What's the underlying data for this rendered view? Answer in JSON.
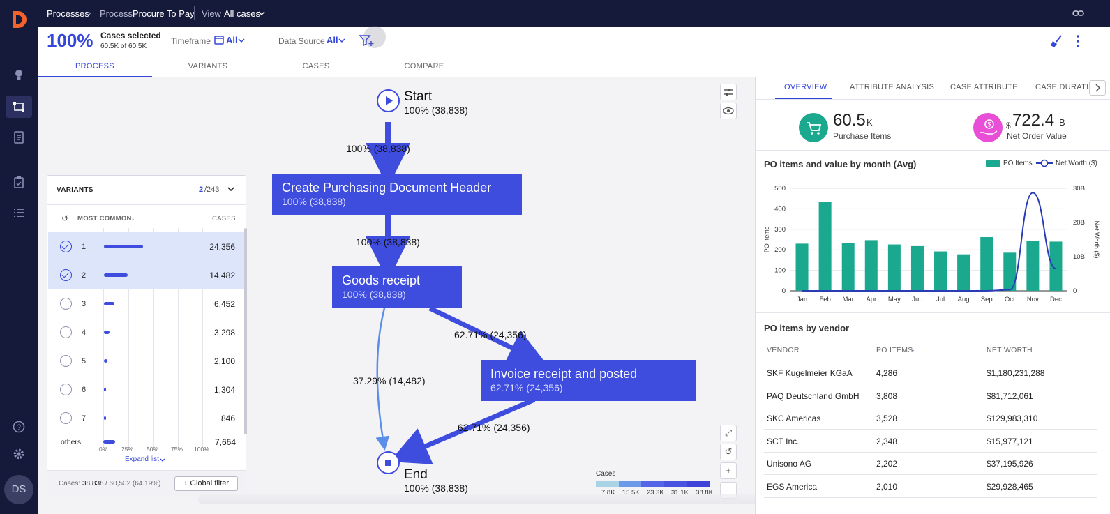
{
  "topbar": {
    "processes": "Processes",
    "process_label": "Process",
    "process_name": "Procure To Pay",
    "view_label": "View",
    "view_value": "All cases"
  },
  "filterbar": {
    "percent": "100%",
    "cases_selected": "Cases selected",
    "cases_count": "60.5K of 60.5K",
    "timeframe_label": "Timeframe",
    "timeframe_value": "All",
    "datasource_label": "Data Source",
    "datasource_value": "All"
  },
  "tabs": [
    "PROCESS",
    "VARIANTS",
    "CASES",
    "COMPARE"
  ],
  "flow": {
    "start_title": "Start",
    "start_sub": "100% (38,838)",
    "end_title": "End",
    "end_sub": "100% (38,838)",
    "nodes": [
      {
        "title": "Create Purchasing Document Header",
        "sub": "100% (38,838)"
      },
      {
        "title": "Goods receipt",
        "sub": "100% (38,838)"
      },
      {
        "title": "Invoice receipt and posted",
        "sub": "62.71% (24,356)"
      }
    ],
    "edges": [
      "100% (38,838)",
      "100% (38,838)",
      "62.71% (24,356)",
      "37.29% (14,482)",
      "62.71% (24,356)"
    ],
    "legend": {
      "title": "Cases",
      "ticks": [
        "7.8K",
        "15.5K",
        "23.3K",
        "31.1K",
        "38.8K"
      ],
      "colors": [
        "#a8d4e6",
        "#6d9ae8",
        "#5565e8",
        "#4a53e0",
        "#3f43da"
      ]
    }
  },
  "variants": {
    "title": "VARIANTS",
    "selected": "2",
    "total": "/243",
    "sort_label": "MOST COMMON",
    "cases_header": "CASES",
    "rows": [
      {
        "num": "1",
        "cases": "24,356",
        "selected": true,
        "share": 0.627
      },
      {
        "num": "2",
        "cases": "14,482",
        "selected": true,
        "share": 0.373
      },
      {
        "num": "3",
        "cases": "6,452",
        "selected": false,
        "share": 0.166
      },
      {
        "num": "4",
        "cases": "3,298",
        "selected": false,
        "share": 0.085
      },
      {
        "num": "5",
        "cases": "2,100",
        "selected": false,
        "share": 0.054
      },
      {
        "num": "6",
        "cases": "1,304",
        "selected": false,
        "share": 0.034
      },
      {
        "num": "7",
        "cases": "846",
        "selected": false,
        "share": 0.022
      }
    ],
    "others_label": "others",
    "others_cases": "7,664",
    "axis": [
      "0%",
      "25%",
      "50%",
      "75%",
      "100%"
    ],
    "expand": "Expand list",
    "footer_cases_label": "Cases:",
    "footer_cases": "38,838",
    "footer_total": "/ 60,502 (64.19%)",
    "global_filter": "+ Global filter"
  },
  "right": {
    "tabs": [
      "OVERVIEW",
      "ATTRIBUTE ANALYSIS",
      "CASE ATTRIBUTE",
      "CASE DURATIO"
    ],
    "kpi1": {
      "value": "60.5",
      "unit": "K",
      "label": "Purchase Items"
    },
    "kpi2": {
      "prefix": "$",
      "value": "722.4",
      "unit": "B",
      "label": "Net Order Value"
    },
    "chart_title": "PO items and value by month (Avg)",
    "table_title": "PO items by vendor",
    "table_headers": [
      "VENDOR",
      "PO ITEMS",
      "NET WORTH"
    ],
    "table_rows": [
      [
        "SKF Kugelmeier KGaA",
        "4,286",
        "$1,180,231,288"
      ],
      [
        "PAQ Deutschland GmbH",
        "3,808",
        "$81,712,061"
      ],
      [
        "SKC Americas",
        "3,528",
        "$129,983,310"
      ],
      [
        "SCT Inc.",
        "2,348",
        "$15,977,121"
      ],
      [
        "Unisono AG",
        "2,202",
        "$37,195,926"
      ],
      [
        "EGS America",
        "2,010",
        "$29,928,465"
      ]
    ]
  },
  "nav": {
    "avatar": "DS"
  },
  "colors": {
    "accent": "#3f4ddf",
    "teal": "#1aa88f",
    "pink": "#e84fd6",
    "navy": "#161a3a"
  },
  "chart_data": {
    "type": "bar",
    "title": "PO items and value by month (Avg)",
    "categories": [
      "Jan",
      "Feb",
      "Mar",
      "Apr",
      "May",
      "Jun",
      "Jul",
      "Aug",
      "Sep",
      "Oct",
      "Nov",
      "Dec"
    ],
    "series": [
      {
        "name": "PO Items",
        "type": "bar",
        "axis": "left",
        "values": [
          230,
          432,
          232,
          247,
          226,
          218,
          192,
          178,
          262,
          186,
          242,
          240
        ]
      },
      {
        "name": "Net Worth ($)",
        "type": "line",
        "axis": "right",
        "values": [
          0,
          0,
          0,
          0,
          0,
          0,
          0,
          0,
          0,
          0.3,
          28.7,
          6.5
        ]
      }
    ],
    "ylabel": "PO Items",
    "y2label": "Net Worth ($)",
    "ylim": [
      0,
      500
    ],
    "yticks": [
      "0",
      "100",
      "200",
      "300",
      "400",
      "500"
    ],
    "y2lim": [
      0,
      30
    ],
    "y2ticks": [
      "0",
      "10B",
      "20B",
      "30B"
    ],
    "legend": "top-right",
    "grid": "horizontal"
  }
}
